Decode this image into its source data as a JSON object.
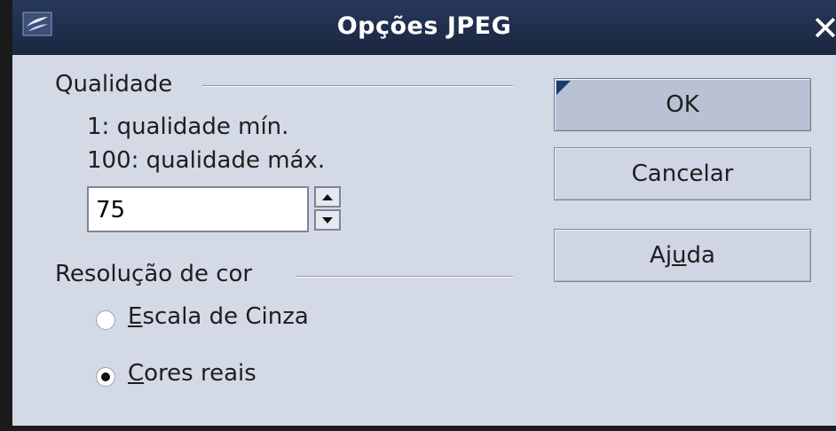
{
  "window": {
    "title": "Opções JPEG",
    "close_glyph": "✕"
  },
  "quality": {
    "group_title": "Qualidade",
    "hint_min": "1: qualidade mín.",
    "hint_max": "100: qualidade máx.",
    "value": "75"
  },
  "color": {
    "group_title": "Resolução de cor",
    "options": [
      {
        "prefix": "",
        "mnemonic": "E",
        "rest": "scala de Cinza",
        "checked": false
      },
      {
        "prefix": "",
        "mnemonic": "C",
        "rest": "ores reais",
        "checked": true
      }
    ]
  },
  "buttons": {
    "ok": "OK",
    "cancel": "Cancelar",
    "help_prefix": "Aj",
    "help_mnemonic": "u",
    "help_rest": "da"
  },
  "colors": {
    "dialog_bg": "#d4d9e6",
    "titlebar": "#1f2d4a"
  },
  "icons": {
    "app": "openoffice-gull-icon",
    "close": "close-icon",
    "spin_up": "arrow-up-icon",
    "spin_down": "arrow-down-icon"
  }
}
